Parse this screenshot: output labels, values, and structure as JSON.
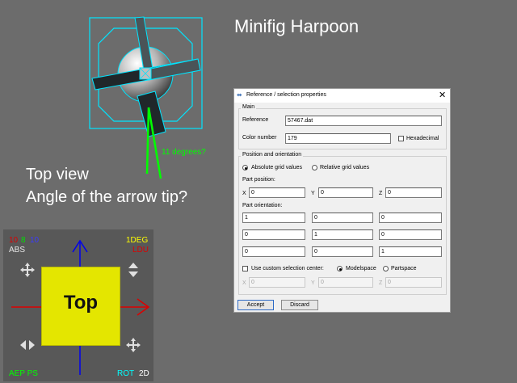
{
  "title": "Minifig Harpoon",
  "question": {
    "line1": "Top view",
    "line2": "Angle of the arrow tip?"
  },
  "annotation": "11 degrees?",
  "dialog": {
    "title": "Reference / selection properties",
    "main_group": "Main",
    "reference_label": "Reference",
    "reference_value": "57467.dat",
    "color_label": "Color number",
    "color_value": "179",
    "hexadecimal_label": "Hexadecimal",
    "position_group": "Position and orientation",
    "absolute_grid_label": "Absolute grid values",
    "relative_grid_label": "Relative grid values",
    "part_position_label": "Part position:",
    "x_label": "X",
    "x_value": "0",
    "y_label": "Y",
    "y_value": "0",
    "z_label": "Z",
    "z_value": "0",
    "part_orientation_label": "Part orientation:",
    "orientation": [
      [
        "1",
        "0",
        "0"
      ],
      [
        "0",
        "1",
        "0"
      ],
      [
        "0",
        "0",
        "1"
      ]
    ],
    "custom_center_label": "Use custom selection center:",
    "modelspace_label": "Modelspace",
    "partspace_label": "Partspace",
    "cx_label": "X",
    "cx_value": "0",
    "cy_label": "Y",
    "cy_value": "0",
    "cz_label": "Z",
    "cz_value": "0",
    "accept_label": "Accept",
    "discard_label": "Discard"
  },
  "navcube": {
    "face_label": "Top",
    "step_10_a": "10",
    "step_8": "8",
    "step_10_b": "10",
    "abs_label": "ABS",
    "deg_label": "1DEG",
    "ldu_label": "LDU",
    "aep_ps_label": "AEP PS",
    "rot_label": "ROT",
    "view_2d_label": "2D"
  },
  "colors": {
    "background": "#6c6c6c",
    "outline_cyan": "#00e5ff",
    "annotation_green": "#00ff00",
    "cube_face": "#e4e600",
    "arrow_blue": "#0000ee",
    "arrow_red": "#dd0000"
  }
}
